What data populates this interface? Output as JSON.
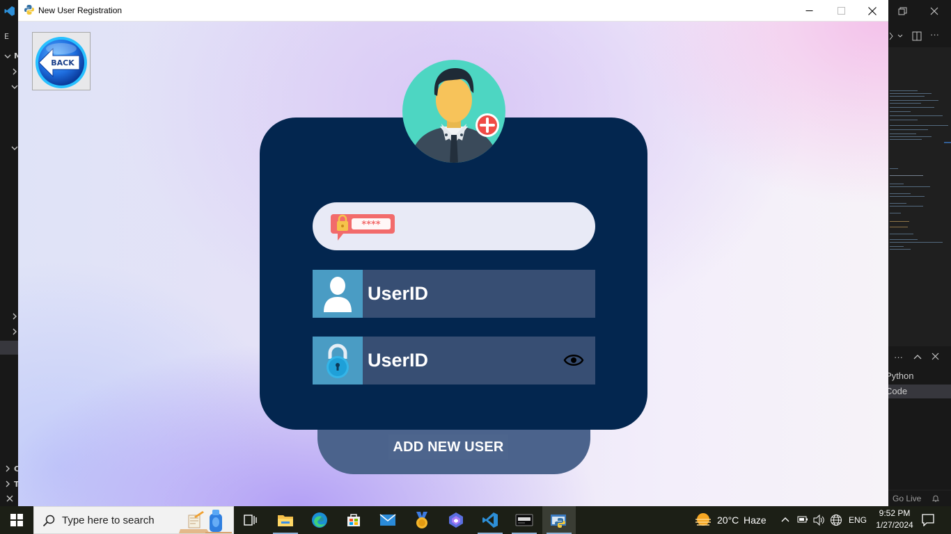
{
  "window": {
    "title": "New User Registration",
    "minimize_icon": "minimize-icon",
    "maximize_icon": "maximize-icon",
    "close_icon": "close-icon"
  },
  "back_button": {
    "label": "BACK"
  },
  "form": {
    "avatar_icon": "add-user-avatar-icon",
    "password_badge_icon": "password-lock-badge-icon",
    "password_badge_text": "****",
    "userid_field": {
      "label": "UserID",
      "icon": "user-icon"
    },
    "password_field": {
      "label": "UserID",
      "icon": "padlock-icon",
      "toggle_icon": "eye-icon"
    },
    "add_button_label": "ADD NEW USER"
  },
  "colors": {
    "card": "#03264f",
    "field_bg": "#374e73",
    "field_side": "#4a9cc4",
    "add_button": "#4b638c",
    "top_field": "#e8eaf6"
  },
  "background_vscode": {
    "left_letters": [
      "E",
      "M",
      "C",
      "T"
    ],
    "right_panel_rows": [
      "Python",
      "Code"
    ],
    "status_text": "Go Live"
  },
  "taskbar": {
    "search_placeholder": "Type here to search",
    "weather_temp": "20°C",
    "weather_text": "Haze",
    "language": "ENG",
    "time": "9:52 PM",
    "date": "1/27/2024",
    "pinned": [
      "task-view",
      "file-explorer",
      "edge",
      "microsoft-store",
      "mail",
      "medal-app",
      "copilot",
      "vscode",
      "terminal-app",
      "python-app"
    ]
  }
}
